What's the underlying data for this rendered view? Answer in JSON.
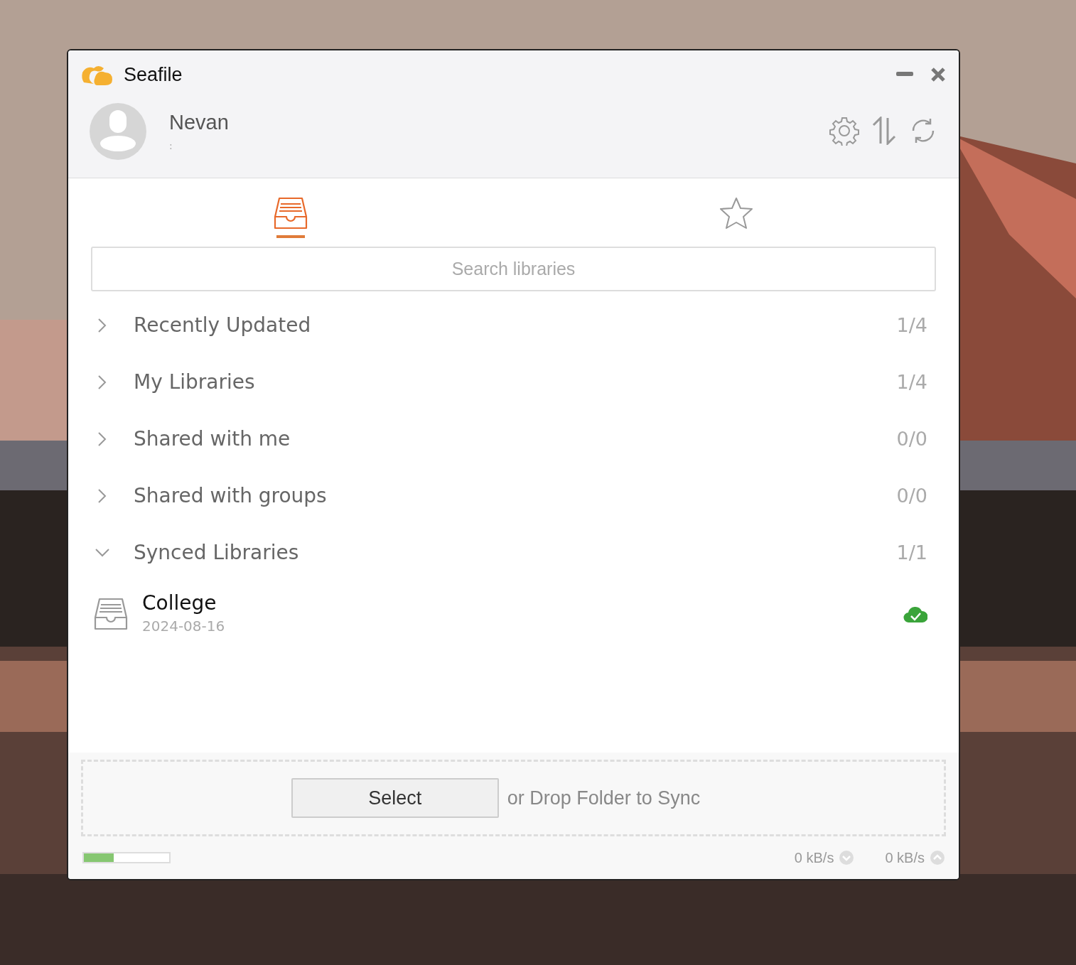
{
  "window": {
    "title": "Seafile"
  },
  "account": {
    "name": "Nevan",
    "server": ":"
  },
  "tabs": [
    {
      "kind": "libraries",
      "selected": true
    },
    {
      "kind": "starred",
      "selected": false
    }
  ],
  "search": {
    "placeholder": "Search libraries"
  },
  "categories": [
    {
      "label": "Recently Updated",
      "count": "1/4",
      "expanded": false
    },
    {
      "label": "My Libraries",
      "count": "1/4",
      "expanded": false
    },
    {
      "label": "Shared with me",
      "count": "0/0",
      "expanded": false
    },
    {
      "label": "Shared with groups",
      "count": "0/0",
      "expanded": false
    },
    {
      "label": "Synced Libraries",
      "count": "1/1",
      "expanded": true,
      "children": [
        {
          "name": "College",
          "date": "2024-08-16",
          "synced": true
        }
      ]
    }
  ],
  "drop_zone": {
    "button": "Select",
    "text": "or Drop Folder to Sync"
  },
  "status_bar": {
    "level": 0.35,
    "download": "0 kB/s",
    "upload": "0 kB/s"
  }
}
